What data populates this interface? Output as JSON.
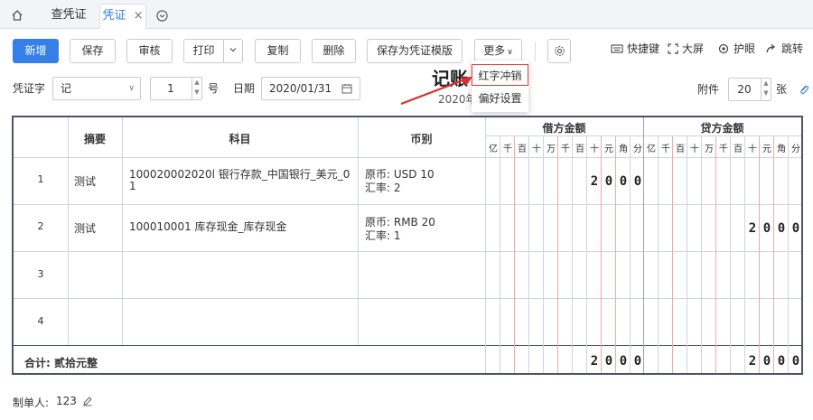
{
  "tabs": {
    "home_icon": "home-icon",
    "items": [
      "查凭证",
      "凭证"
    ],
    "close_glyph": "×"
  },
  "toolbar": {
    "new": "新增",
    "save": "保存",
    "audit": "审核",
    "print": "打印",
    "copy": "复制",
    "delete": "删除",
    "save_template": "保存为凭证模版",
    "more": "更多",
    "shortcuts": "快捷键",
    "fullscreen": "大屏",
    "eye_care": "护眼",
    "jump": "跳转"
  },
  "more_menu": [
    "红字冲销",
    "偏好设置"
  ],
  "voucher": {
    "word_label": "凭证字",
    "word_value": "记",
    "number_value": "1",
    "number_suffix": "号",
    "date_label": "日期",
    "date_value": "2020/01/31",
    "title": "记账",
    "subtitle": "2020年",
    "attach_label": "附件",
    "attach_value": "20",
    "attach_suffix": "张"
  },
  "table": {
    "headers": {
      "summary": "摘要",
      "account": "科目",
      "currency": "币别",
      "debit": "借方金额",
      "credit": "贷方金额"
    },
    "units": [
      "亿",
      "千",
      "百",
      "十",
      "万",
      "千",
      "百",
      "十",
      "元",
      "角",
      "分"
    ],
    "rows": [
      {
        "no": "1",
        "summary": "测试",
        "account_line1": "100020002020l 银行存款_中国银行_美元_0",
        "account_line2": "1",
        "currency_line1": "原币: USD 10",
        "currency_line2": "汇率: 2",
        "debit_digits": [
          "",
          "",
          "",
          "",
          "",
          "",
          "",
          "2",
          "0",
          "0",
          "0"
        ],
        "credit_digits": [
          "",
          "",
          "",
          "",
          "",
          "",
          "",
          "",
          "",
          "",
          ""
        ]
      },
      {
        "no": "2",
        "summary": "测试",
        "account_line1": "100010001 库存现金_库存现金",
        "account_line2": "",
        "currency_line1": "原币: RMB 20",
        "currency_line2": "汇率: 1",
        "debit_digits": [
          "",
          "",
          "",
          "",
          "",
          "",
          "",
          "",
          "",
          "",
          ""
        ],
        "credit_digits": [
          "",
          "",
          "",
          "",
          "",
          "",
          "",
          "2",
          "0",
          "0",
          "0"
        ]
      },
      {
        "no": "3",
        "summary": "",
        "account_line1": "",
        "account_line2": "",
        "currency_line1": "",
        "currency_line2": "",
        "debit_digits": [
          "",
          "",
          "",
          "",
          "",
          "",
          "",
          "",
          "",
          "",
          ""
        ],
        "credit_digits": [
          "",
          "",
          "",
          "",
          "",
          "",
          "",
          "",
          "",
          "",
          ""
        ]
      },
      {
        "no": "4",
        "summary": "",
        "account_line1": "",
        "account_line2": "",
        "currency_line1": "",
        "currency_line2": "",
        "debit_digits": [
          "",
          "",
          "",
          "",
          "",
          "",
          "",
          "",
          "",
          "",
          ""
        ],
        "credit_digits": [
          "",
          "",
          "",
          "",
          "",
          "",
          "",
          "",
          "",
          "",
          ""
        ]
      }
    ],
    "total_label": "合计: 贰拾元整",
    "total_debit_digits": [
      "",
      "",
      "",
      "",
      "",
      "",
      "",
      "2",
      "0",
      "0",
      "0"
    ],
    "total_credit_digits": [
      "",
      "",
      "",
      "",
      "",
      "",
      "",
      "2",
      "0",
      "0",
      "0"
    ]
  },
  "footer": {
    "maker_label": "制单人:",
    "maker_value": "123"
  },
  "colors": {
    "accent": "#3480e8",
    "menu_highlight": "#e23c39",
    "arrow": "#d9322f",
    "unit_separator": "#f2a9a0"
  }
}
